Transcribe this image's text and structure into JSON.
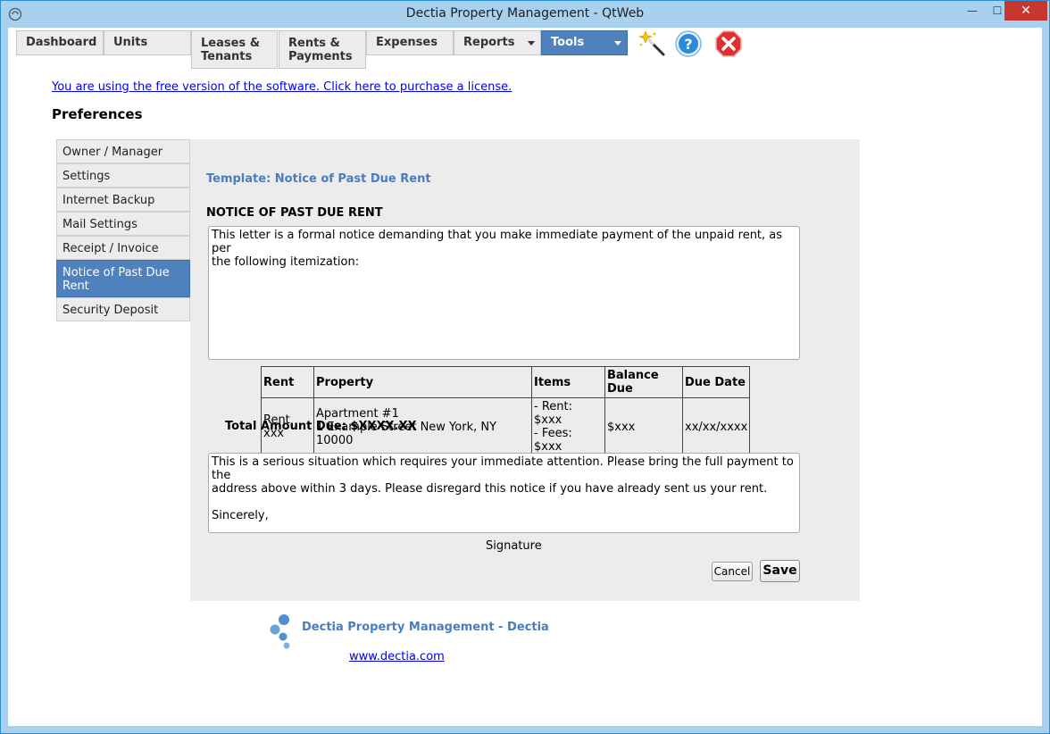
{
  "window": {
    "title": "Dectia Property Management - QtWeb",
    "minimize": "—",
    "maximize": "☐",
    "close": "✕"
  },
  "nav": {
    "tabs": [
      {
        "line1": "Dashboard",
        "line2": ""
      },
      {
        "line1": "Units",
        "line2": ""
      },
      {
        "line1": "Leases &",
        "line2": "Tenants"
      },
      {
        "line1": "Rents &",
        "line2": "Payments"
      },
      {
        "line1": "Expenses",
        "line2": ""
      },
      {
        "line1": "Reports",
        "line2": ""
      },
      {
        "line1": "Tools",
        "line2": ""
      }
    ],
    "icons": [
      "magic-wand-icon",
      "help-icon",
      "exit-icon"
    ]
  },
  "license_link": "You are using the free version of the software. Click here to purchase a license.",
  "page_title": "Preferences",
  "sidebar": {
    "items": [
      {
        "line1": "Owner / Manager",
        "line2": ""
      },
      {
        "line1": "Settings",
        "line2": ""
      },
      {
        "line1": "Internet Backup",
        "line2": ""
      },
      {
        "line1": "Mail Settings",
        "line2": ""
      },
      {
        "line1": "Receipt / Invoice",
        "line2": ""
      },
      {
        "line1": "Notice of Past Due",
        "line2": "Rent"
      },
      {
        "line1": "Security Deposit",
        "line2": ""
      }
    ],
    "active_index": 5
  },
  "panel": {
    "template_title": "Template: Notice of Past Due Rent",
    "notice_heading": "NOTICE OF PAST DUE RENT",
    "intro_text": "This letter is a formal notice demanding that you make immediate payment of the unpaid rent, as per\nthe following itemization:",
    "table": {
      "headers": [
        "Rent",
        "Property",
        "Items",
        "Balance Due",
        "Due Date"
      ],
      "row": {
        "rent": "Rent xxx",
        "property_line1": "Apartment #1",
        "property_line2": "1 Example Street New York, NY 10000",
        "items_line1": "- Rent: $xxx",
        "items_line2": "- Fees: $xxx",
        "balance": "$xxx",
        "due_date": "xx/xx/xxxx"
      }
    },
    "total": "Total Amount Due: $XXXX.XX",
    "closing_text": "This is a serious situation which requires your immediate attention. Please bring the full payment to the\naddress above within 3 days. Please disregard this notice if you have already sent us your rent.\n\nSincerely,",
    "signature": "Signature",
    "cancel_label": "Cancel",
    "save_label": "Save"
  },
  "footer": {
    "brand": "Dectia Property Management - Dectia",
    "link": "www.dectia.com"
  },
  "colors": {
    "accent": "#4f81bd",
    "link": "#0000ee",
    "brand_text": "#4a7cc0",
    "titlebar": "#a8d1f0"
  }
}
